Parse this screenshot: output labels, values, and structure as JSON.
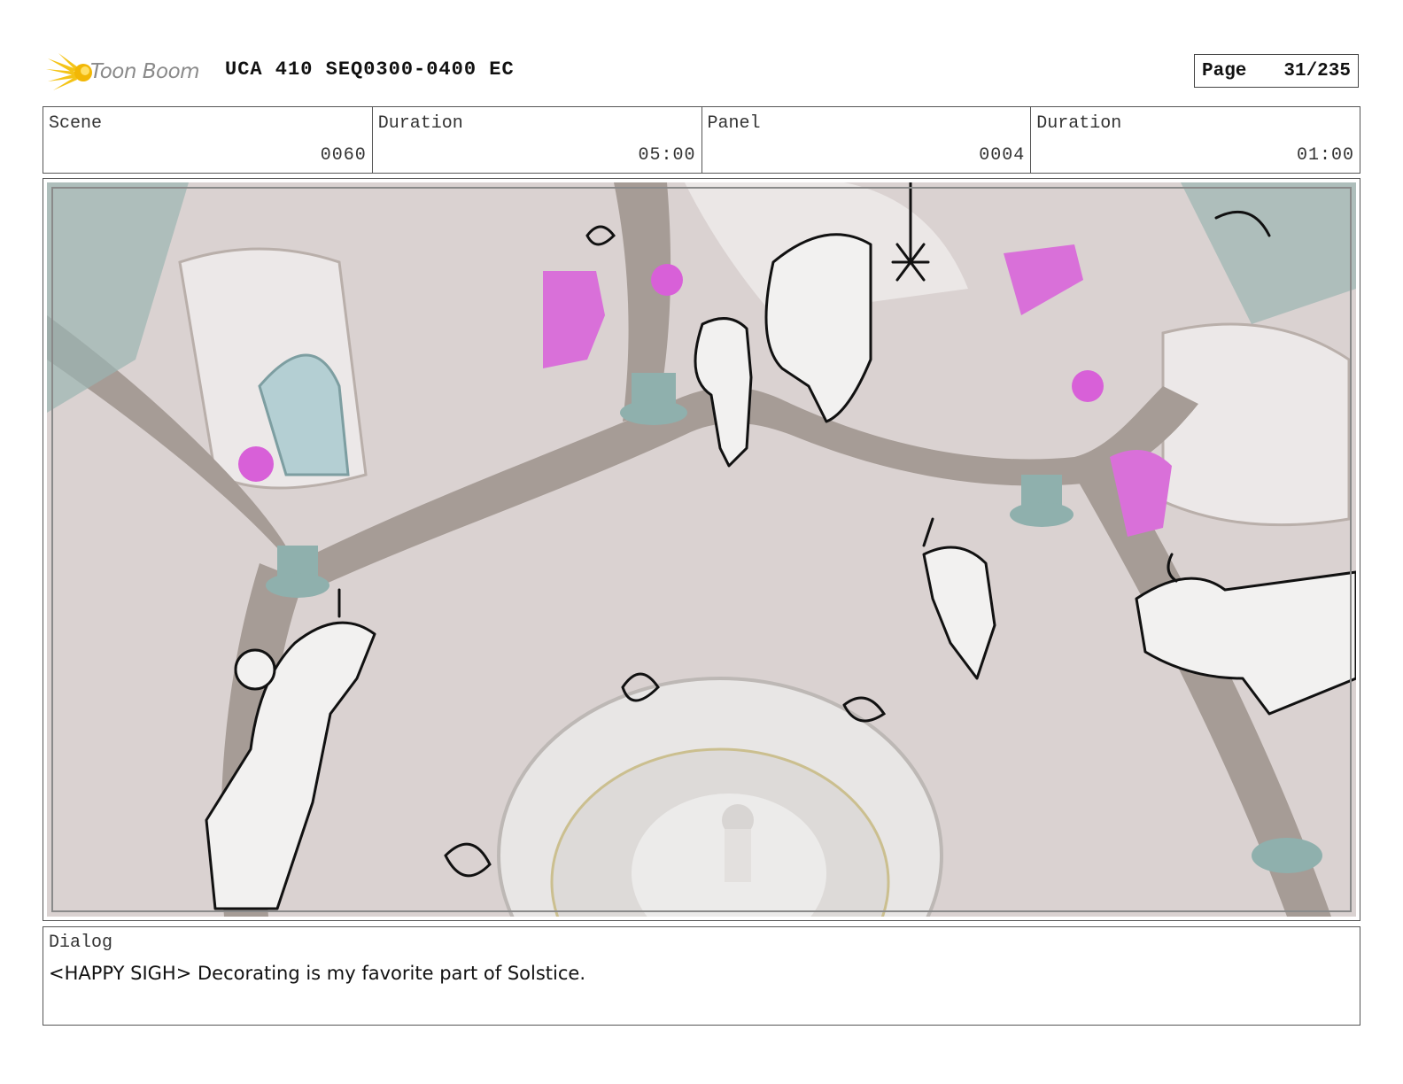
{
  "header": {
    "logo_text": "Toon Boom",
    "doc_title": "UCA 410 SEQ0300-0400 EC",
    "page_label": "Page",
    "page_value": "31/235"
  },
  "info": {
    "scene_label": "Scene",
    "scene_value": "0060",
    "scene_duration_label": "Duration",
    "scene_duration_value": "05:00",
    "panel_label": "Panel",
    "panel_value": "0004",
    "panel_duration_label": "Duration",
    "panel_duration_value": "01:00"
  },
  "panel": {
    "image_icon": "storyboard-sketch-image"
  },
  "dialog": {
    "label": "Dialog",
    "text": "<HAPPY SIGH> Decorating is my favorite part of Solstice."
  },
  "colors": {
    "floor": "#d9d0cf",
    "beam": "#a59b95",
    "pillar_teal": "#8fb0ad",
    "ornament_magenta": "#d860d8",
    "sketch_line": "#111111"
  }
}
